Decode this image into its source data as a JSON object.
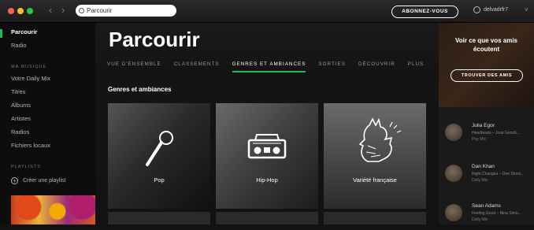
{
  "topbar": {
    "search_value": "Parcourir",
    "upgrade_label": "ABONNEZ-VOUS",
    "username": "delvadrfr7"
  },
  "sidebar": {
    "items_top": [
      {
        "label": "Parcourir",
        "active": true
      },
      {
        "label": "Radio",
        "active": false
      }
    ],
    "library_header": "MA MUSIQUE",
    "library_items": [
      "Votre Daily Mix",
      "Titres",
      "Albums",
      "Artistes",
      "Radios",
      "Fichiers locaux"
    ],
    "playlists_header": "PLAYLISTS",
    "new_playlist_label": "Créer une playlist"
  },
  "main": {
    "title": "Parcourir",
    "tabs": [
      {
        "label": "VUE D'ENSEMBLE",
        "active": false
      },
      {
        "label": "CLASSEMENTS",
        "active": false
      },
      {
        "label": "GENRES ET AMBIANCES",
        "active": true
      },
      {
        "label": "SORTIES",
        "active": false
      },
      {
        "label": "DÉCOUVRIR",
        "active": false
      },
      {
        "label": "PLUS",
        "active": false
      }
    ],
    "section_title": "Genres et ambiances",
    "genres": [
      {
        "label": "Pop",
        "icon": "microphone-icon"
      },
      {
        "label": "Hip-Hop",
        "icon": "boombox-icon"
      },
      {
        "label": "Variété française",
        "icon": "rooster-icon"
      }
    ]
  },
  "friends": {
    "message": "Voir ce que vos amis écoutent",
    "button_label": "TROUVER DES AMIS",
    "list": [
      {
        "name": "Julia Egor",
        "detail": "Heartbeats – José Gonzá...",
        "source": "Pop Mix"
      },
      {
        "name": "Dan Khan",
        "detail": "Night Changes – One Direct...",
        "source": "Daily Mix"
      },
      {
        "name": "Sean Adams",
        "detail": "Feeling Good – Nina Simo...",
        "source": "Daily Mix"
      }
    ]
  }
}
